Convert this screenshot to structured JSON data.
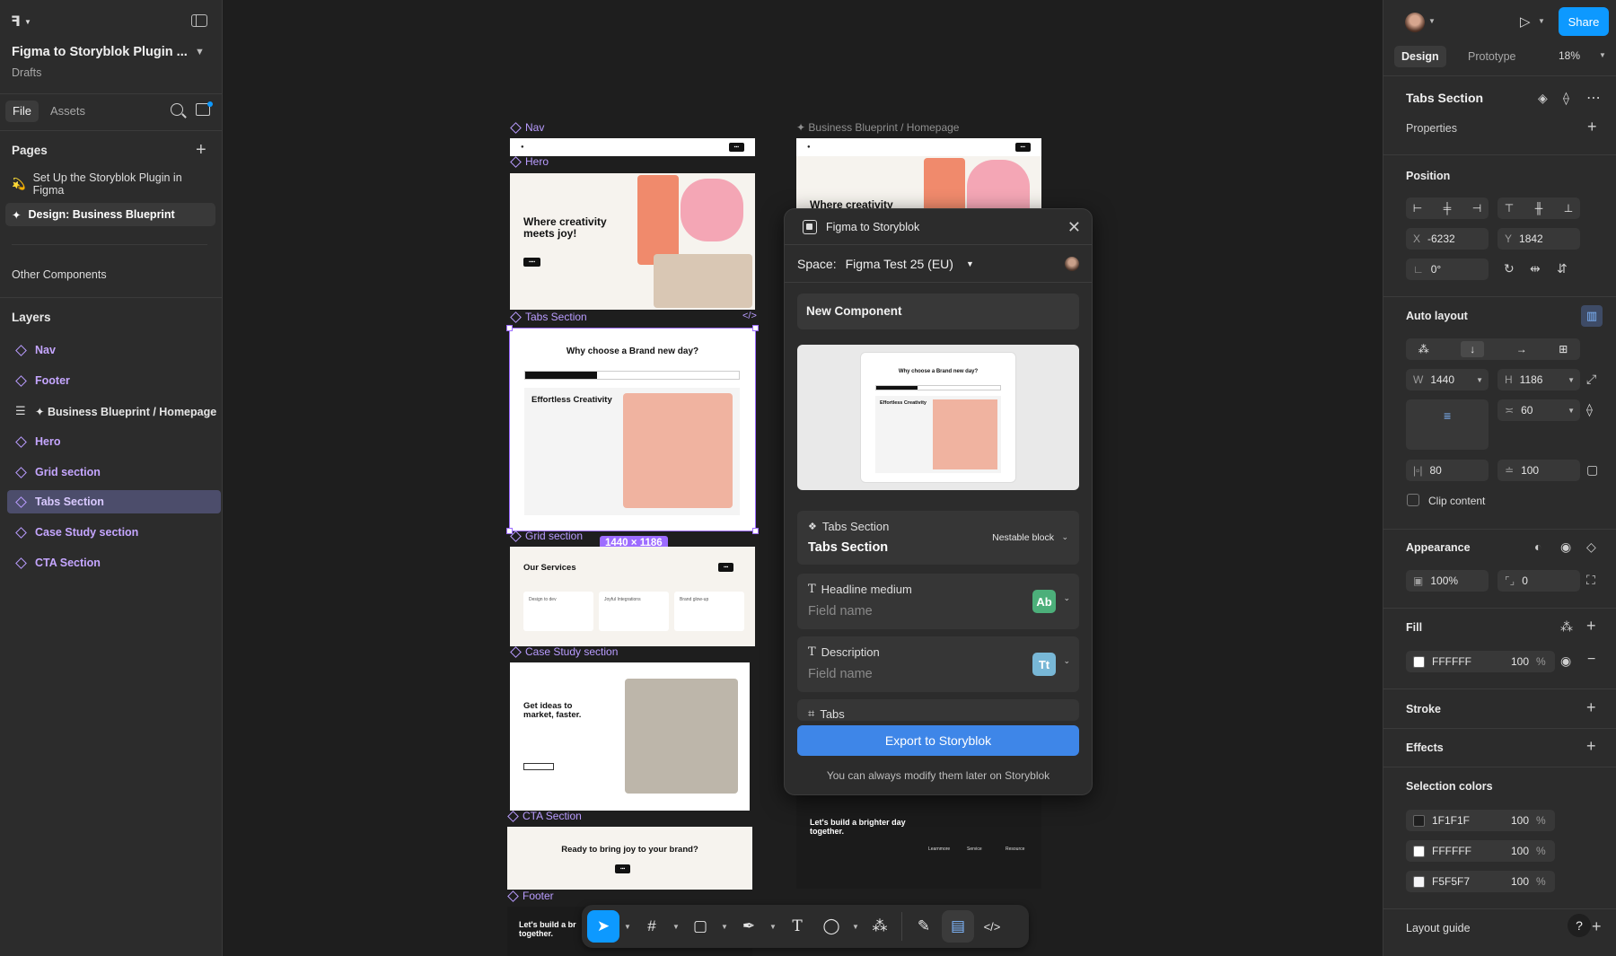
{
  "file": {
    "title": "Figma to Storyblok Plugin ...",
    "location": "Drafts"
  },
  "left_tabs": {
    "file": "File",
    "assets": "Assets"
  },
  "pages": {
    "heading": "Pages",
    "items": [
      {
        "emoji": "💫",
        "label": "Set Up the Storyblok Plugin in Figma"
      },
      {
        "emoji": "✦",
        "label": "Design: Business Blueprint"
      }
    ],
    "other": "Other Components"
  },
  "layers": {
    "heading": "Layers",
    "items": [
      {
        "label": "Nav",
        "kind": "component"
      },
      {
        "label": "Footer",
        "kind": "component"
      },
      {
        "label": "✦ Business Blueprint / Homepage",
        "kind": "frame"
      },
      {
        "label": "Hero",
        "kind": "component"
      },
      {
        "label": "Grid section",
        "kind": "component"
      },
      {
        "label": "Tabs Section",
        "kind": "component",
        "selected": true
      },
      {
        "label": "Case Study section",
        "kind": "component"
      },
      {
        "label": "CTA Section",
        "kind": "component"
      }
    ]
  },
  "canvas": {
    "labels": {
      "nav": "Nav",
      "hero": "Hero",
      "tabs": "Tabs Section",
      "grid": "Grid section",
      "case": "Case Study section",
      "cta": "CTA Section",
      "footer": "Footer",
      "blueprint": "✦ Business Blueprint / Homepage"
    },
    "size_badge": "1440 × 1186",
    "hero_title": "Where creativity meets joy!",
    "blueprint_hero_title": "Where creativity",
    "tabs_title": "Why choose a Brand new day?",
    "tabs_heading": "Effortless Creativity",
    "grid_title": "Our Services",
    "grid_cards": [
      "Design to dev",
      "Joyful Integrations",
      "Brand glow-up"
    ],
    "case_title": "Get ideas to market, faster.",
    "cta_title": "Ready to bring joy to your brand?",
    "footer_title": "Let's build a br together.",
    "blueprint_footer_title": "Let's build a brighter day together.",
    "blueprint_footer_cols": [
      "Learnmore",
      "Service",
      "Resource"
    ]
  },
  "plugin": {
    "title": "Figma to Storyblok",
    "space_label": "Space:",
    "space_value": "Figma Test 25 (EU)",
    "component_name": "New Component",
    "fields": [
      {
        "type": "component",
        "label": "Tabs Section",
        "value": "Tabs Section",
        "tag": "Nestable block"
      },
      {
        "type": "text",
        "label": "Headline medium",
        "value": "Field name",
        "badge": "Ab",
        "badge_color": "#4caf7a"
      },
      {
        "type": "text",
        "label": "Description",
        "value": "Field name",
        "badge": "Tt",
        "badge_color": "#78b7d6"
      },
      {
        "type": "grid",
        "label": "Tabs"
      }
    ],
    "export_label": "Export to Storyblok",
    "note": "You can always modify them later on Storyblok"
  },
  "right": {
    "share": "Share",
    "tabs": {
      "design": "Design",
      "prototype": "Prototype"
    },
    "zoom": "18%",
    "selection": "Tabs Section",
    "properties": "Properties",
    "position": "Position",
    "x": "-6232",
    "y": "1842",
    "rotation": "0°",
    "auto_layout": "Auto layout",
    "w": "1440",
    "h": "1186",
    "gap": "60",
    "pad_h": "80",
    "pad_v": "100",
    "clip": "Clip content",
    "appearance": "Appearance",
    "opacity": "100%",
    "radius": "0",
    "fill": "Fill",
    "fill_hex": "FFFFFF",
    "fill_opacity": "100",
    "stroke": "Stroke",
    "effects": "Effects",
    "selection_colors": "Selection colors",
    "colors": [
      {
        "hex": "1F1F1F",
        "opacity": "100",
        "swatch": "#1F1F1F"
      },
      {
        "hex": "FFFFFF",
        "opacity": "100",
        "swatch": "#FFFFFF"
      },
      {
        "hex": "F5F5F7",
        "opacity": "100",
        "swatch": "#F5F5F7"
      }
    ],
    "layout_guide": "Layout guide",
    "percent": "%",
    "help": "?"
  },
  "colors": {
    "accent": "#0d99ff",
    "component": "#b99cff",
    "selection": "#9d6cff",
    "export": "#3e86e8"
  }
}
